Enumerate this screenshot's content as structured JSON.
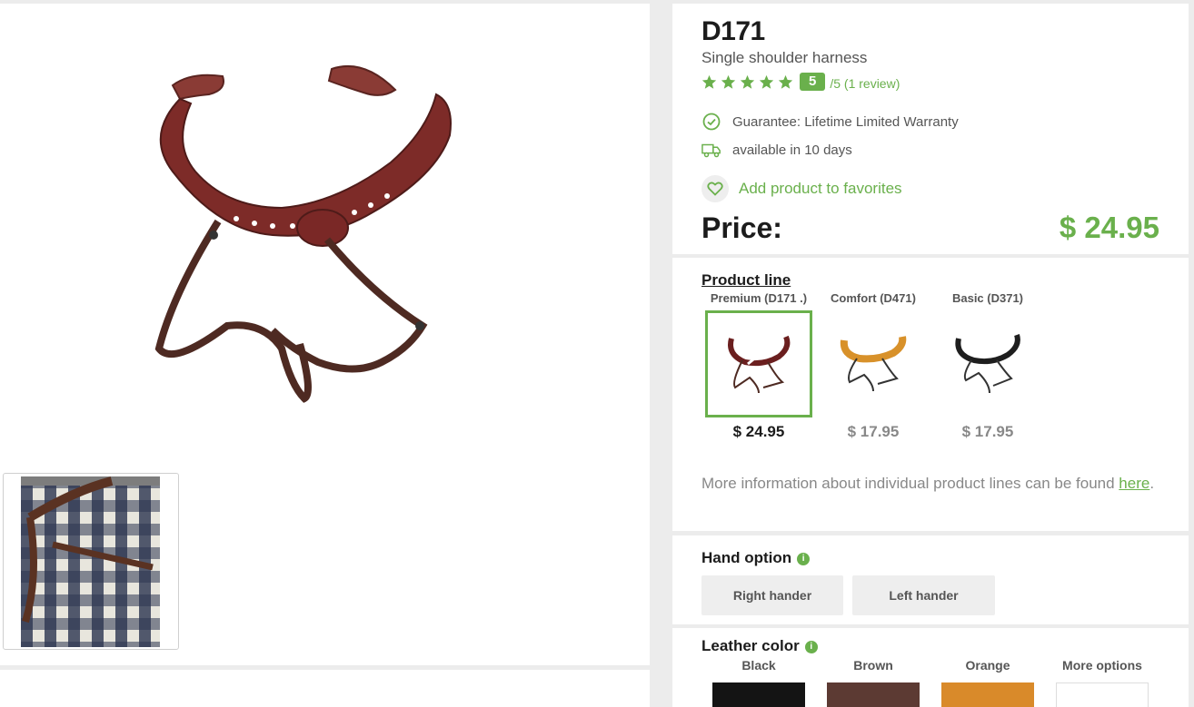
{
  "product": {
    "code": "D171",
    "subtitle": "Single shoulder harness",
    "rating": {
      "stars": 5,
      "score": "5",
      "suffix": "/5 (1 review)"
    },
    "guarantee": "Guarantee: Lifetime Limited Warranty",
    "availability": "available in 10 days",
    "favorites_label": "Add product to favorites",
    "price_label": "Price:",
    "price_value": "$ 24.95"
  },
  "product_line": {
    "title": "Product line",
    "variants": [
      {
        "name": "Premium (D171 .)",
        "price": "$ 24.95",
        "selected": true,
        "color": "#6b1f1f"
      },
      {
        "name": "Comfort (D471)",
        "price": "$ 17.95",
        "selected": false,
        "color": "#d8912a"
      },
      {
        "name": "Basic (D371)",
        "price": "$ 17.95",
        "selected": false,
        "color": "#1e1e1e"
      }
    ],
    "more_info_text": "More information about individual product lines can be found ",
    "more_info_link": "here",
    "more_info_end": "."
  },
  "hand_option": {
    "title": "Hand option",
    "info_icon": "i",
    "options": [
      "Right hander",
      "Left hander"
    ]
  },
  "leather_color": {
    "title": "Leather color",
    "info_icon": "i",
    "options": [
      {
        "name": "Black",
        "color": "#141414"
      },
      {
        "name": "Brown",
        "color": "#5c3a33"
      },
      {
        "name": "Orange",
        "color": "#d98a2a"
      },
      {
        "name": "More options",
        "color": "#ffffff"
      }
    ]
  },
  "colors": {
    "accent": "#6ab04c",
    "text_dark": "#1c1c1c",
    "muted": "#888888"
  }
}
